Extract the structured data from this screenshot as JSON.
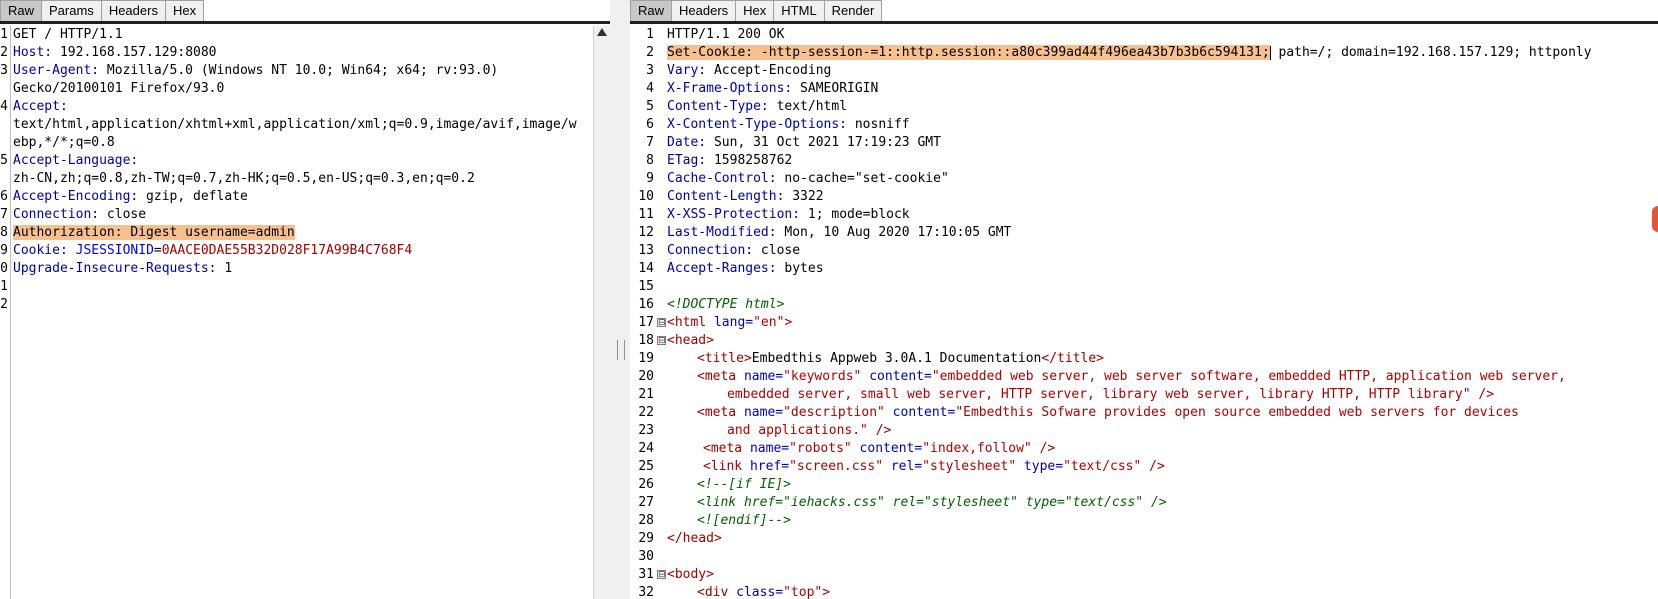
{
  "request": {
    "tabs": [
      "Raw",
      "Params",
      "Headers",
      "Hex"
    ],
    "active_tab": "Raw",
    "line_numbers": [
      "1",
      "2",
      "3",
      "",
      "4",
      "",
      "5",
      "",
      "6",
      "7",
      "8",
      "9",
      "0",
      "1",
      "2"
    ],
    "lines": {
      "l1": "GET / HTTP/1.1",
      "l2k": "Host:",
      "l2v": " 192.168.157.129:8080",
      "l3k": "User-Agent:",
      "l3v": " Mozilla/5.0 (Windows NT 10.0; Win64; x64; rv:93.0)",
      "l3c": "Gecko/20100101 Firefox/93.0",
      "l4k": "Accept:",
      "l4c1": "text/html,application/xhtml+xml,application/xml;q=0.9,image/avif,image/w",
      "l4c2": "ebp,*/*;q=0.8",
      "l5k": "Accept-Language:",
      "l5c": "zh-CN,zh;q=0.8,zh-TW;q=0.7,zh-HK;q=0.5,en-US;q=0.3,en;q=0.2",
      "l6k": "Accept-Encoding:",
      "l6v": " gzip, deflate",
      "l7k": "Connection:",
      "l7v": " close",
      "l8": "Authorization: Digest username=admin",
      "l9k": "Cookie:",
      "l9n": " JSESSIONID",
      "l9e": "=",
      "l9v": "0AACE0DAE55B32D028F17A99B4C768F4",
      "l10k": "Upgrade-Insecure-Requests:",
      "l10v": " 1"
    }
  },
  "response": {
    "tabs": [
      "Raw",
      "Headers",
      "Hex",
      "HTML",
      "Render"
    ],
    "active_tab": "Raw",
    "line_numbers": [
      "1",
      "2",
      "3",
      "4",
      "5",
      "6",
      "7",
      "8",
      "9",
      "10",
      "11",
      "12",
      "13",
      "14",
      "15",
      "16",
      "17",
      "18",
      "19",
      "20",
      "21",
      "22",
      "23",
      "24",
      "25",
      "26",
      "27",
      "28",
      "29",
      "30",
      "31",
      "32"
    ],
    "fold_markers": {
      "17": "⊟",
      "18": "⊟",
      "31": "⊟"
    },
    "lines": {
      "r1": "HTTP/1.1 200 OK",
      "r2hl": "Set-Cookie: -http-session-=1::http.session::a80c399ad44f496ea43b7b3b6c594131;",
      "r2rest": " path=/; domain=192.168.157.129; httponly",
      "r3k": "Vary:",
      "r3v": " Accept-Encoding",
      "r4k": "X-Frame-Options:",
      "r4v": " SAMEORIGIN",
      "r5k": "Content-Type:",
      "r5v": " text/html",
      "r6k": "X-Content-Type-Options:",
      "r6v": " nosniff",
      "r7k": "Date:",
      "r7v": " Sun, 31 Oct 2021 17:19:23 GMT",
      "r8k": "ETag:",
      "r8v": " 1598258762",
      "r9k": "Cache-Control:",
      "r9v": " no-cache=\"set-cookie\"",
      "r10k": "Content-Length:",
      "r10v": " 3322",
      "r11k": "X-XSS-Protection:",
      "r11v": " 1; mode=block",
      "r12k": "Last-Modified:",
      "r12v": " Mon, 10 Aug 2020 17:10:05 GMT",
      "r13k": "Connection:",
      "r13v": " close",
      "r14k": "Accept-Ranges:",
      "r14v": " bytes",
      "r16": "<!DOCTYPE html>",
      "r17a": "<html ",
      "r17b": "lang=",
      "r17c": "\"en\"",
      "r17d": ">",
      "r18": "<head>",
      "r19a": "<title>",
      "r19b": "Embedthis Appweb 3.0A.1 Documentation",
      "r19c": "</title>",
      "r20a": "<meta ",
      "r20b": "name=",
      "r20c": "\"keywords\"",
      "r20d": " content=",
      "r20e": "\"embedded web server, web server software, embedded HTTP, application web server,",
      "r21a": "embedded server, small web server, HTTP server, library web server, library HTTP, HTTP library\"",
      "r21b": " />",
      "r22a": "<meta ",
      "r22b": "name=",
      "r22c": "\"description\"",
      "r22d": " content=",
      "r22e": "\"Embedthis Sofware provides open source embedded web servers for devices",
      "r23a": "and applications.\"",
      "r23b": " />",
      "r24a": "<meta ",
      "r24b": "name=",
      "r24c": "\"robots\"",
      "r24d": " content=",
      "r24e": "\"index,follow\"",
      "r24f": " />",
      "r25a": "<link ",
      "r25b": "href=",
      "r25c": "\"screen.css\"",
      "r25d": " rel=",
      "r25e": "\"stylesheet\"",
      "r25f": " type=",
      "r25g": "\"text/css\"",
      "r25h": " />",
      "r26": "<!--[if IE]>",
      "r27": "<link href=\"iehacks.css\" rel=\"stylesheet\" type=\"text/css\" />",
      "r28": "<![endif]-->",
      "r29": "</head>",
      "r31": "<body>",
      "r32a": "<div ",
      "r32b": "class=",
      "r32c": "\"top\"",
      "r32d": ">"
    }
  }
}
